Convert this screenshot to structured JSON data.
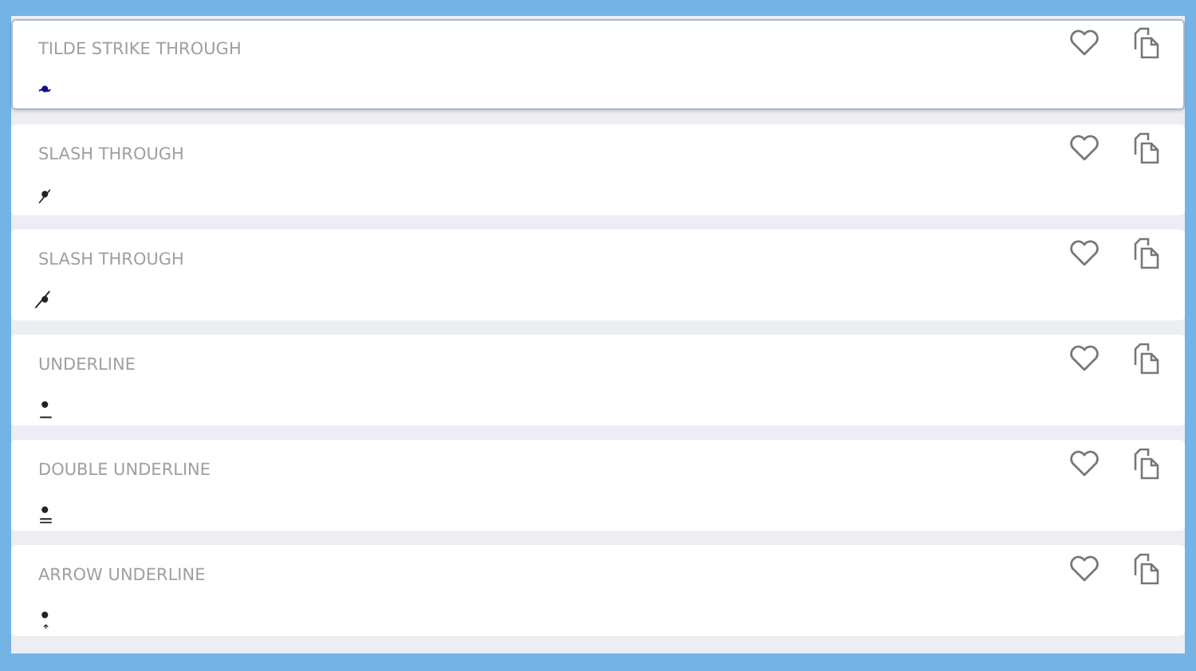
{
  "styles": [
    {
      "label": "TILDE STRIKE THROUGH",
      "sample": "•̴",
      "selected": true
    },
    {
      "label": "SLASH THROUGH",
      "sample": "•̷",
      "selected": false
    },
    {
      "label": "SLASH THROUGH",
      "sample": "•̸",
      "selected": false
    },
    {
      "label": "UNDERLINE",
      "sample": "•̲",
      "selected": false
    },
    {
      "label": "DOUBLE UNDERLINE",
      "sample": "•̳",
      "selected": false
    },
    {
      "label": "ARROW UNDERLINE",
      "sample": "•͎",
      "selected": false
    }
  ]
}
